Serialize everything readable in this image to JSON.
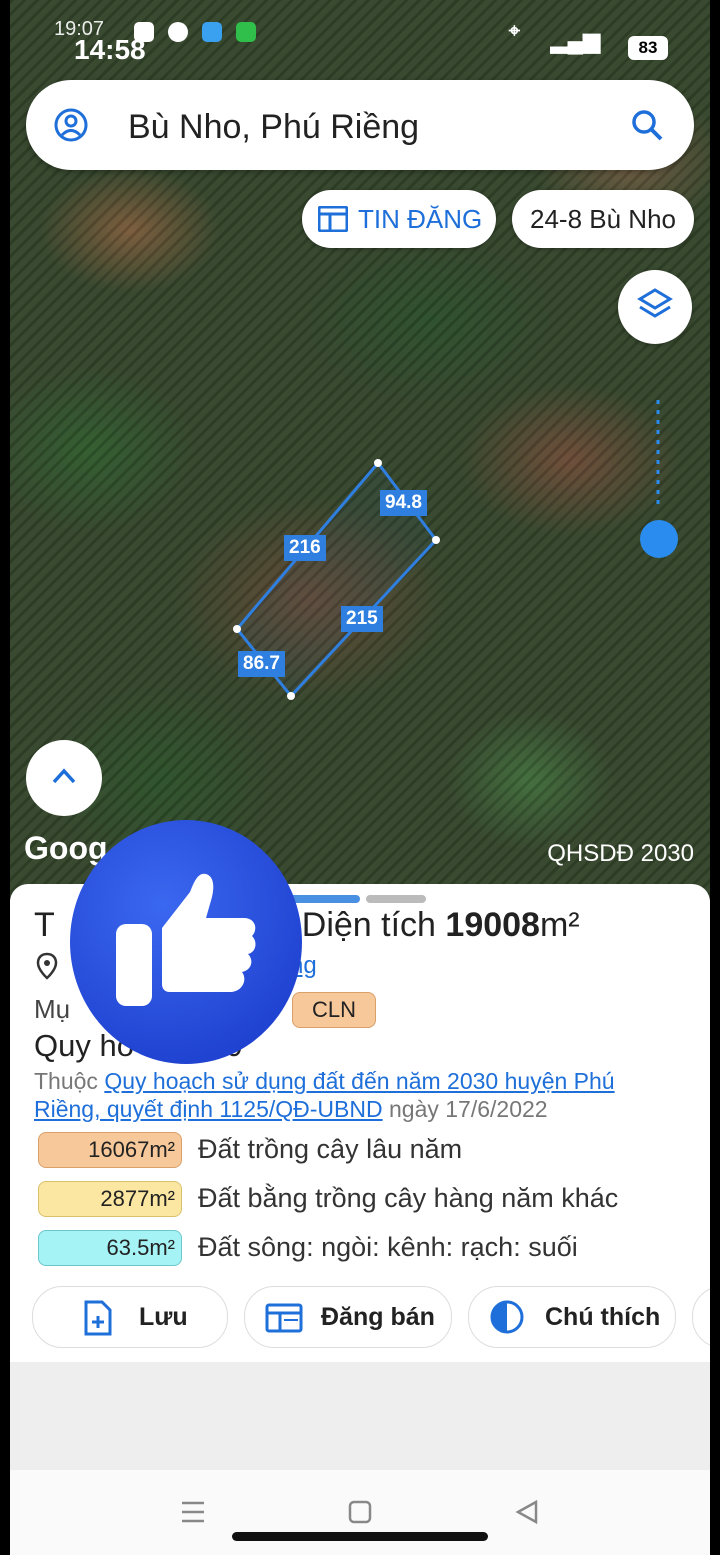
{
  "status": {
    "time_small": "19:07",
    "time": "14:58",
    "battery": "83"
  },
  "search": {
    "query": "Bù Nho, Phú Riềng"
  },
  "chips": {
    "tin_dang": "TIN ĐĂNG",
    "address": "24-8 Bù Nho"
  },
  "map": {
    "google": "Goog",
    "layer": "QHSDĐ 2030",
    "dims": {
      "top": "94.8",
      "left": "216",
      "right": "215",
      "bottom": "86.7"
    }
  },
  "sheet": {
    "title_prefix": "T",
    "title_label": "Diện tích ",
    "title_value": "19008",
    "title_unit": "m²",
    "address_link": "ng",
    "purpose_prefix": "Mụ",
    "purpose_code": "CLN",
    "plan_title": "Quy ho       Đ 2030",
    "plan_desc_prefix": "Thuộc ",
    "plan_desc_link": "Quy hoạch sử dụng đất đến năm 2030 huyện Phú Riềng, quyết định 1125/QĐ-UBND",
    "plan_desc_suffix": " ngày 17/6/2022",
    "areas": [
      {
        "value": "16067m²",
        "label": "Đất trồng cây lâu năm",
        "color": "#f6c89a",
        "border": "#d9a06a"
      },
      {
        "value": "2877m²",
        "label": "Đất bằng trồng cây hàng năm khác",
        "color": "#fbe7a1",
        "border": "#d9c06a"
      },
      {
        "value": "63.5m²",
        "label": "Đất sông: ngòi: kênh: rạch: suối",
        "color": "#a6f3f6",
        "border": "#6ac7cc"
      }
    ],
    "buttons": {
      "save": "Lưu",
      "sell": "Đăng bán",
      "legend": "Chú thích"
    }
  },
  "colors": {
    "accent": "#1e6fd9",
    "plot": "#2f7fe0",
    "like": "#2146d9"
  }
}
